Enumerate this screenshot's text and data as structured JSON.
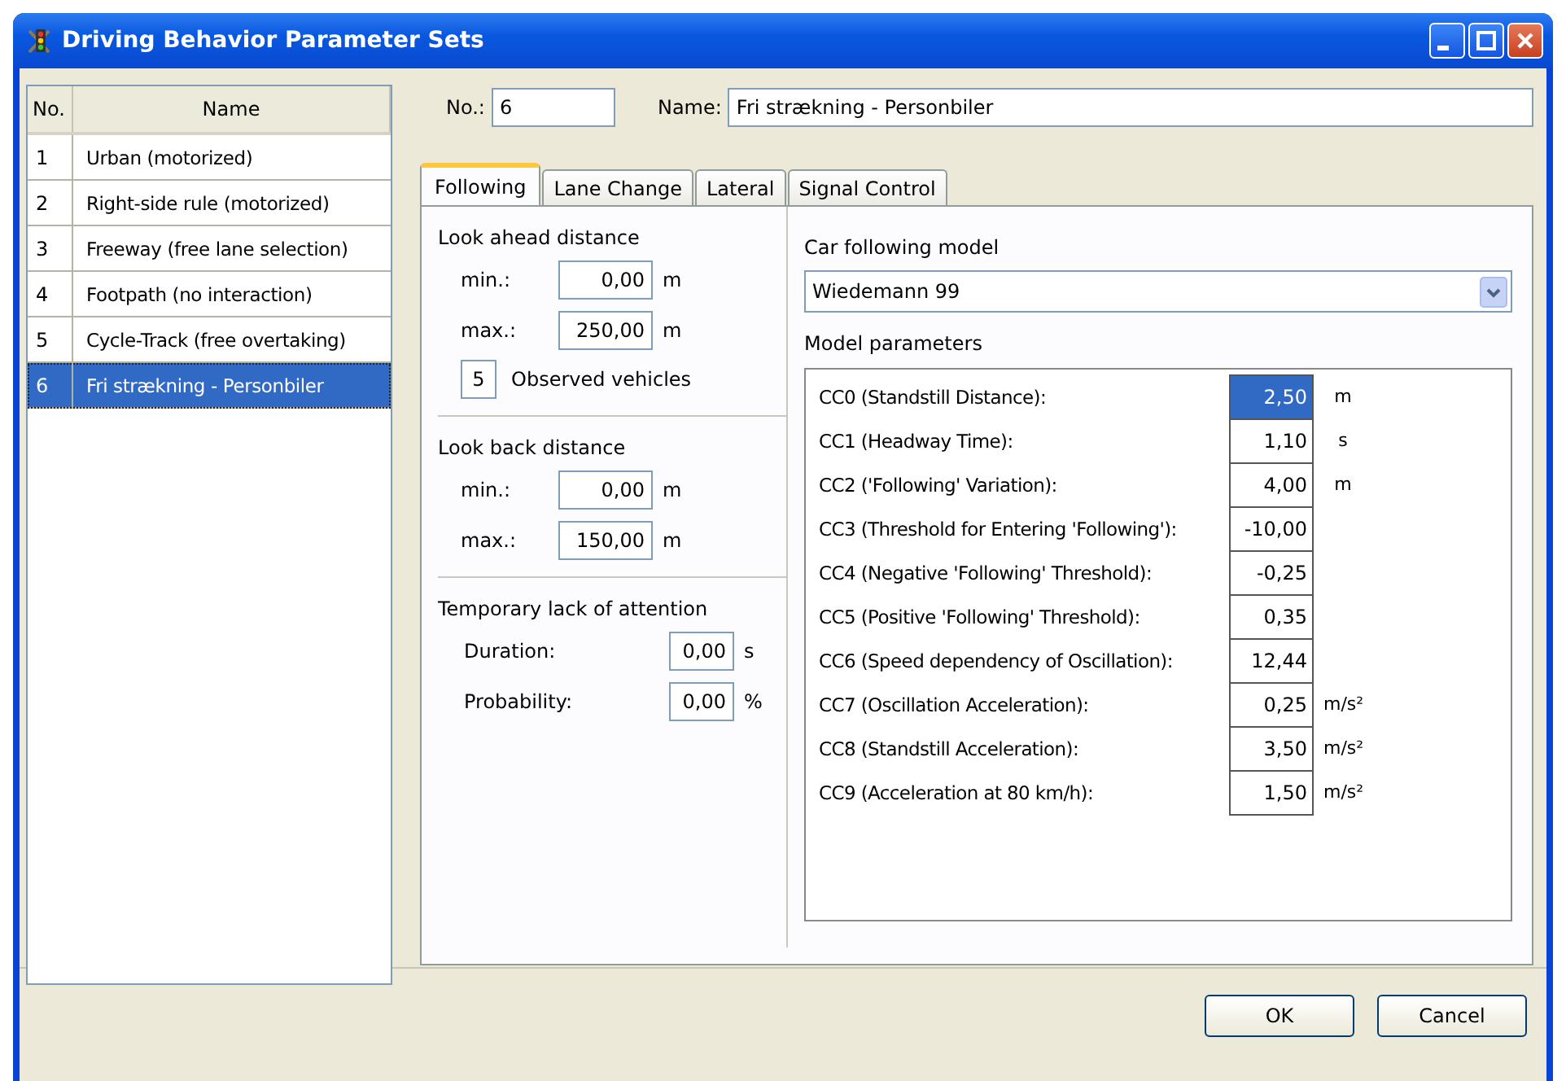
{
  "window": {
    "title": "Driving Behavior Parameter Sets"
  },
  "list": {
    "columns": [
      "No.",
      "Name"
    ],
    "rows": [
      {
        "no": "1",
        "name": "Urban (motorized)",
        "selected": false
      },
      {
        "no": "2",
        "name": "Right-side rule (motorized)",
        "selected": false
      },
      {
        "no": "3",
        "name": "Freeway (free lane selection)",
        "selected": false
      },
      {
        "no": "4",
        "name": "Footpath (no interaction)",
        "selected": false
      },
      {
        "no": "5",
        "name": "Cycle-Track (free overtaking)",
        "selected": false
      },
      {
        "no": "6",
        "name": "Fri strækning - Personbiler",
        "selected": true
      }
    ]
  },
  "header": {
    "no_label": "No.:",
    "no_value": "6",
    "name_label": "Name:",
    "name_value": "Fri strækning - Personbiler"
  },
  "tabs": [
    {
      "label": "Following",
      "selected": true
    },
    {
      "label": "Lane Change",
      "selected": false
    },
    {
      "label": "Lateral",
      "selected": false
    },
    {
      "label": "Signal Control",
      "selected": false
    }
  ],
  "look_ahead": {
    "title": "Look ahead distance",
    "fields": [
      {
        "label": "min.:",
        "value": "0,00",
        "unit": "m"
      },
      {
        "label": "max.:",
        "value": "250,00",
        "unit": "m"
      }
    ],
    "observed_value": "5",
    "observed_label": "Observed vehicles"
  },
  "look_back": {
    "title": "Look back distance",
    "fields": [
      {
        "label": "min.:",
        "value": "0,00",
        "unit": "m"
      },
      {
        "label": "max.:",
        "value": "150,00",
        "unit": "m"
      }
    ]
  },
  "attention": {
    "title": "Temporary lack of attention",
    "fields": [
      {
        "label": "Duration:",
        "value": "0,00",
        "unit": "s"
      },
      {
        "label": "Probability:",
        "value": "0,00",
        "unit": "%"
      }
    ]
  },
  "model": {
    "label": "Car following model",
    "value": "Wiedemann 99",
    "params_label": "Model parameters",
    "params": [
      {
        "label": "CC0 (Standstill Distance):",
        "value": "2,50",
        "unit": "m",
        "selected": true
      },
      {
        "label": "CC1 (Headway Time):",
        "value": "1,10",
        "unit": "s",
        "selected": false
      },
      {
        "label": "CC2 ('Following' Variation):",
        "value": "4,00",
        "unit": "m",
        "selected": false
      },
      {
        "label": "CC3 (Threshold for Entering 'Following'):",
        "value": "-10,00",
        "selected": false
      },
      {
        "label": "CC4 (Negative 'Following' Threshold):",
        "value": "-0,25",
        "selected": false
      },
      {
        "label": "CC5 (Positive 'Following' Threshold):",
        "value": "0,35",
        "selected": false
      },
      {
        "label": "CC6 (Speed dependency of Oscillation):",
        "value": "12,44",
        "selected": false
      },
      {
        "label": "CC7 (Oscillation Acceleration):",
        "value": "0,25",
        "unit": "m/s²",
        "selected": false
      },
      {
        "label": "CC8 (Standstill Acceleration):",
        "value": "3,50",
        "unit": "m/s²",
        "selected": false
      },
      {
        "label": "CC9 (Acceleration at 80 km/h):",
        "value": "1,50",
        "unit": "m/s²",
        "selected": false
      }
    ]
  },
  "buttons": [
    "OK",
    "Cancel"
  ]
}
